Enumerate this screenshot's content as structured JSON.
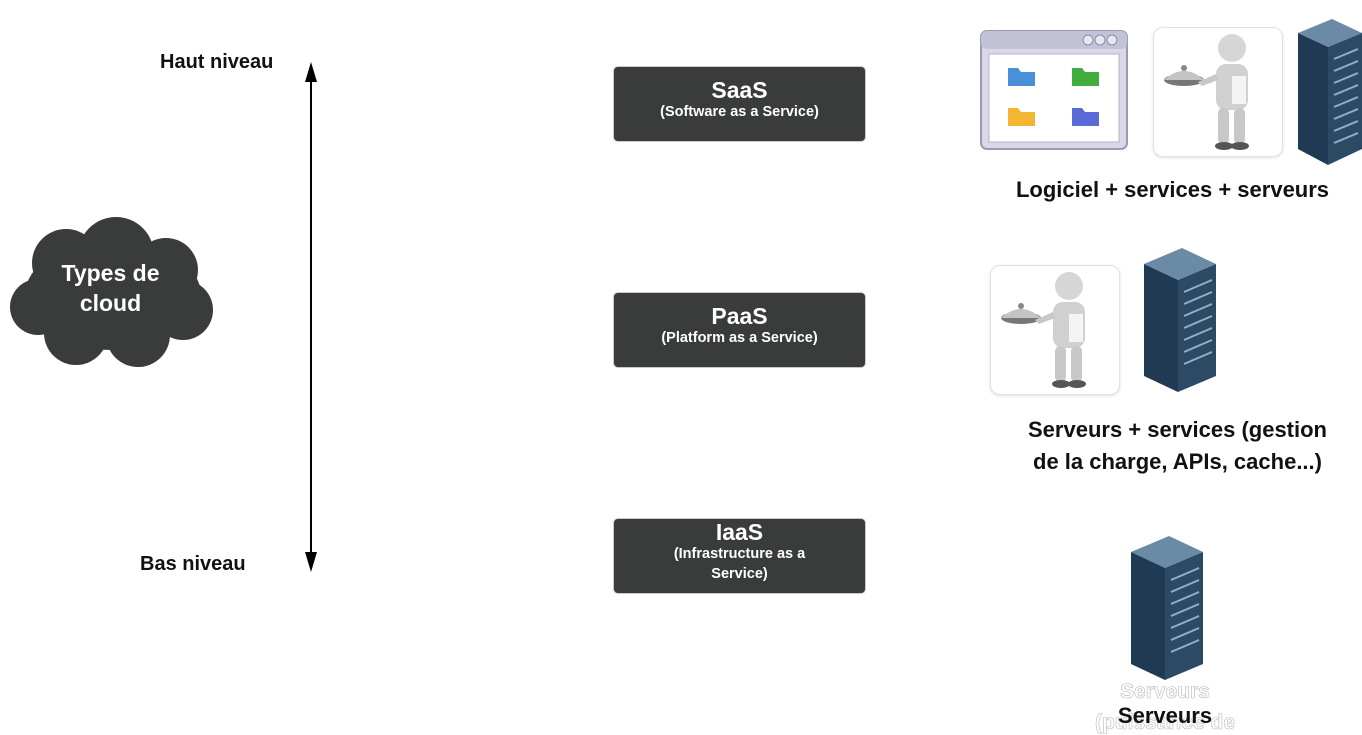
{
  "axis": {
    "top_label": "Haut niveau",
    "bottom_label": "Bas niveau"
  },
  "cloud": {
    "line1": "Types de",
    "line2": "cloud"
  },
  "services": [
    {
      "name": "SaaS",
      "description": "(Software as a Service)"
    },
    {
      "name": "PaaS",
      "description": "(Platform as a Service)"
    },
    {
      "name": "IaaS",
      "description_line1": "(Infrastructure as a",
      "description_line2": "Service)"
    }
  ],
  "captions": {
    "saas": "Logiciel + services + serveurs",
    "paas_line1": "Serveurs + services (gestion",
    "paas_line2": "de la charge, APIs, cache...)",
    "iaas": "Serveurs",
    "iaas_ghost_line1": "Serveurs",
    "iaas_ghost_line2": "(puissance de"
  },
  "icons": [
    "application-window-icon",
    "waiter-icon",
    "server-rack-icon"
  ],
  "colors": {
    "box": "#393c3b",
    "cloud": "#393c3b",
    "server": "#2c4a63",
    "text": "#111111"
  }
}
